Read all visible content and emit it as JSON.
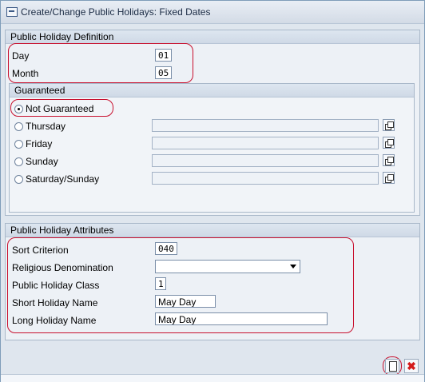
{
  "window": {
    "title": "Create/Change Public Holidays: Fixed Dates"
  },
  "definition": {
    "header": "Public Holiday Definition",
    "day_label": "Day",
    "day_value": "01",
    "month_label": "Month",
    "month_value": "05"
  },
  "guaranteed": {
    "header": "Guaranteed",
    "options": [
      {
        "label": "Not Guaranteed",
        "selected": true
      },
      {
        "label": "Thursday",
        "selected": false,
        "value": ""
      },
      {
        "label": "Friday",
        "selected": false,
        "value": ""
      },
      {
        "label": "Sunday",
        "selected": false,
        "value": ""
      },
      {
        "label": "Saturday/Sunday",
        "selected": false,
        "value": ""
      }
    ]
  },
  "attributes": {
    "header": "Public Holiday Attributes",
    "sort_label": "Sort Criterion",
    "sort_value": "040",
    "religious_label": "Religious Denomination",
    "religious_value": "",
    "class_label": "Public Holiday Class",
    "class_value": "1",
    "short_label": "Short Holiday Name",
    "short_value": "May Day",
    "long_label": "Long Holiday Name",
    "long_value": "May Day"
  },
  "icons": {
    "new": "new-document-icon",
    "cancel": "cancel-icon",
    "copy": "copy-icon",
    "title": "create-change-icon"
  },
  "colors": {
    "highlight": "#c8102e",
    "cancel": "#d31a1a"
  }
}
